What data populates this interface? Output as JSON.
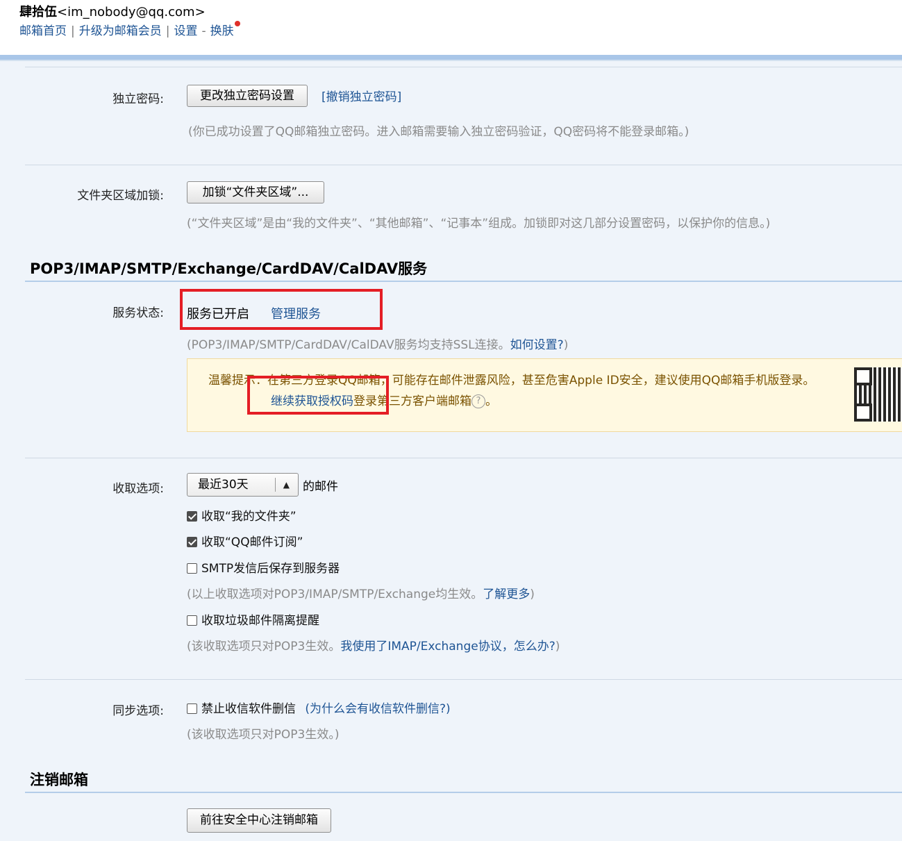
{
  "header": {
    "user_name": "肆拾伍",
    "user_email": "<im_nobody@qq.com>",
    "nav": {
      "home": "邮箱首页",
      "sep1": "|",
      "upgrade": "升级为邮箱会员",
      "sep2": "|",
      "settings": "设置",
      "dash": "-",
      "skin": "换肤"
    }
  },
  "password": {
    "label": "独立密码:",
    "change_button": "更改独立密码设置",
    "revoke_link": "[撤销独立密码]",
    "note": "(你已成功设置了QQ邮箱独立密码。进入邮箱需要输入独立密码验证，QQ密码将不能登录邮箱。)"
  },
  "folder_lock": {
    "label": "文件夹区域加锁:",
    "button": "加锁“文件夹区域”...",
    "note": "(“文件夹区域”是由“我的文件夹”、“其他邮箱”、“记事本”组成。加锁即对这几部分设置密码，以保护你的信息。)"
  },
  "services": {
    "title": "POP3/IMAP/SMTP/Exchange/CardDAV/CalDAV服务",
    "status_label": "服务状态:",
    "status_value": "服务已开启",
    "manage_link": "管理服务",
    "ssl_note_prefix": "(POP3/IMAP/SMTP/CardDAV/CalDAV服务均支持SSL连接。",
    "ssl_note_link": "如何设置?",
    "ssl_note_suffix": ")",
    "tips_line1": "温馨提示：在第三方登录QQ邮箱，可能存在邮件泄露风险，甚至危害Apple ID安全，建议使用QQ邮箱手机版登录。",
    "tips_link": "继续获取授权码",
    "tips_line2_suffix": "登录第三方客户端邮箱",
    "tips_help": "?",
    "tips_end": "。"
  },
  "receive": {
    "label": "收取选项:",
    "select_value": "最近30天",
    "select_suffix": "的邮件",
    "option1": "收取“我的文件夹”",
    "option1_checked": true,
    "option2": "收取“QQ邮件订阅”",
    "option2_checked": true,
    "option3": "SMTP发信后保存到服务器",
    "option3_checked": false,
    "note1_prefix": "(以上收取选项对POP3/IMAP/SMTP/Exchange均生效。",
    "note1_link": "了解更多",
    "note1_suffix": ")",
    "option4": "收取垃圾邮件隔离提醒",
    "option4_checked": false,
    "note2_prefix": "(该收取选项只对POP3生效。",
    "note2_link": "我使用了IMAP/Exchange协议，怎么办?",
    "note2_suffix": ")"
  },
  "sync": {
    "label": "同步选项:",
    "option": "禁止收信软件删信",
    "option_checked": false,
    "why_link": "(为什么会有收信软件删信?)",
    "note": "(该收取选项只对POP3生效。)"
  },
  "cancel": {
    "title": "注销邮箱",
    "button": "前往安全中心注销邮箱"
  },
  "colors": {
    "link": "#1e5494",
    "highlight_box": "#e41e25",
    "tips_bg": "#fff9e1",
    "page_bg": "#eff4fa"
  }
}
